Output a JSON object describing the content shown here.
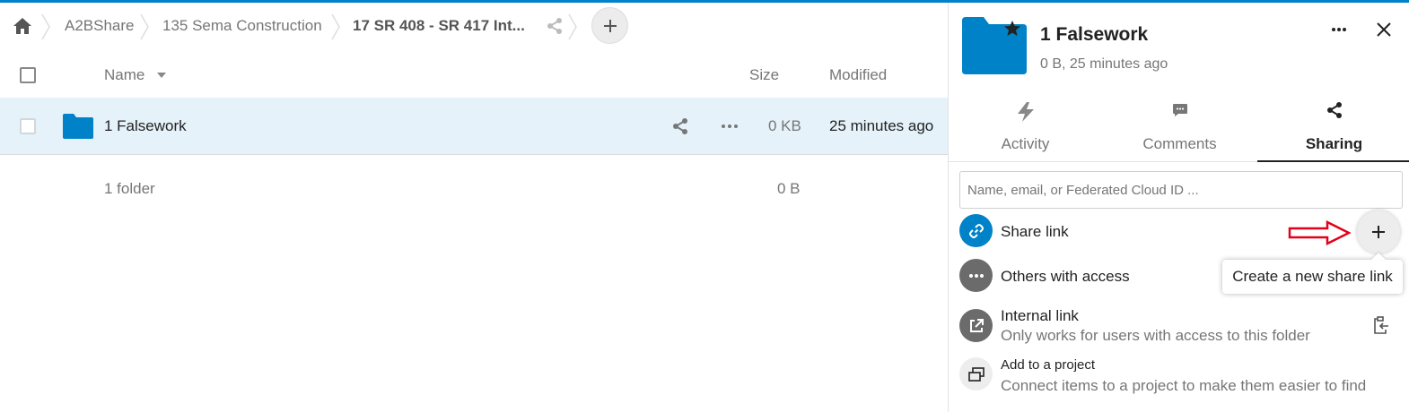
{
  "breadcrumbs": [
    {
      "label": "A2BShare"
    },
    {
      "label": "135 Sema Construction"
    },
    {
      "label": "17 SR 408 - SR 417 Int..."
    }
  ],
  "table": {
    "columns": {
      "name": "Name",
      "size": "Size",
      "modified": "Modified"
    },
    "rows": [
      {
        "name": "1 Falsework",
        "size": "0 KB",
        "modified": "25 minutes ago"
      }
    ],
    "summary": {
      "count": "1 folder",
      "size": "0 B"
    }
  },
  "sidebar": {
    "title": "1 Falsework",
    "subtitle": "0 B, 25 minutes ago",
    "tabs": [
      {
        "label": "Activity"
      },
      {
        "label": "Comments"
      },
      {
        "label": "Sharing"
      }
    ],
    "share_input_placeholder": "Name, email, or Federated Cloud ID ...",
    "share_link": {
      "label": "Share link"
    },
    "tooltip": "Create a new share link",
    "others": {
      "label": "Others with access"
    },
    "internal": {
      "title": "Internal link",
      "desc": "Only works for users with access to this folder"
    },
    "project": {
      "title": "Add to a project",
      "desc": "Connect items to a project to make them easier to find"
    }
  },
  "colors": {
    "accent": "#0082c9",
    "folder": "#0082c9",
    "selected_row": "#e5f2f9",
    "annotation_arrow": "#e3001b"
  },
  "icons": [
    "home-icon",
    "share-icon",
    "plus-icon",
    "folder-icon",
    "more-icon",
    "close-icon",
    "activity-icon",
    "comments-icon",
    "link-icon",
    "external-link-icon",
    "clipboard-icon",
    "project-icon",
    "star-icon"
  ]
}
